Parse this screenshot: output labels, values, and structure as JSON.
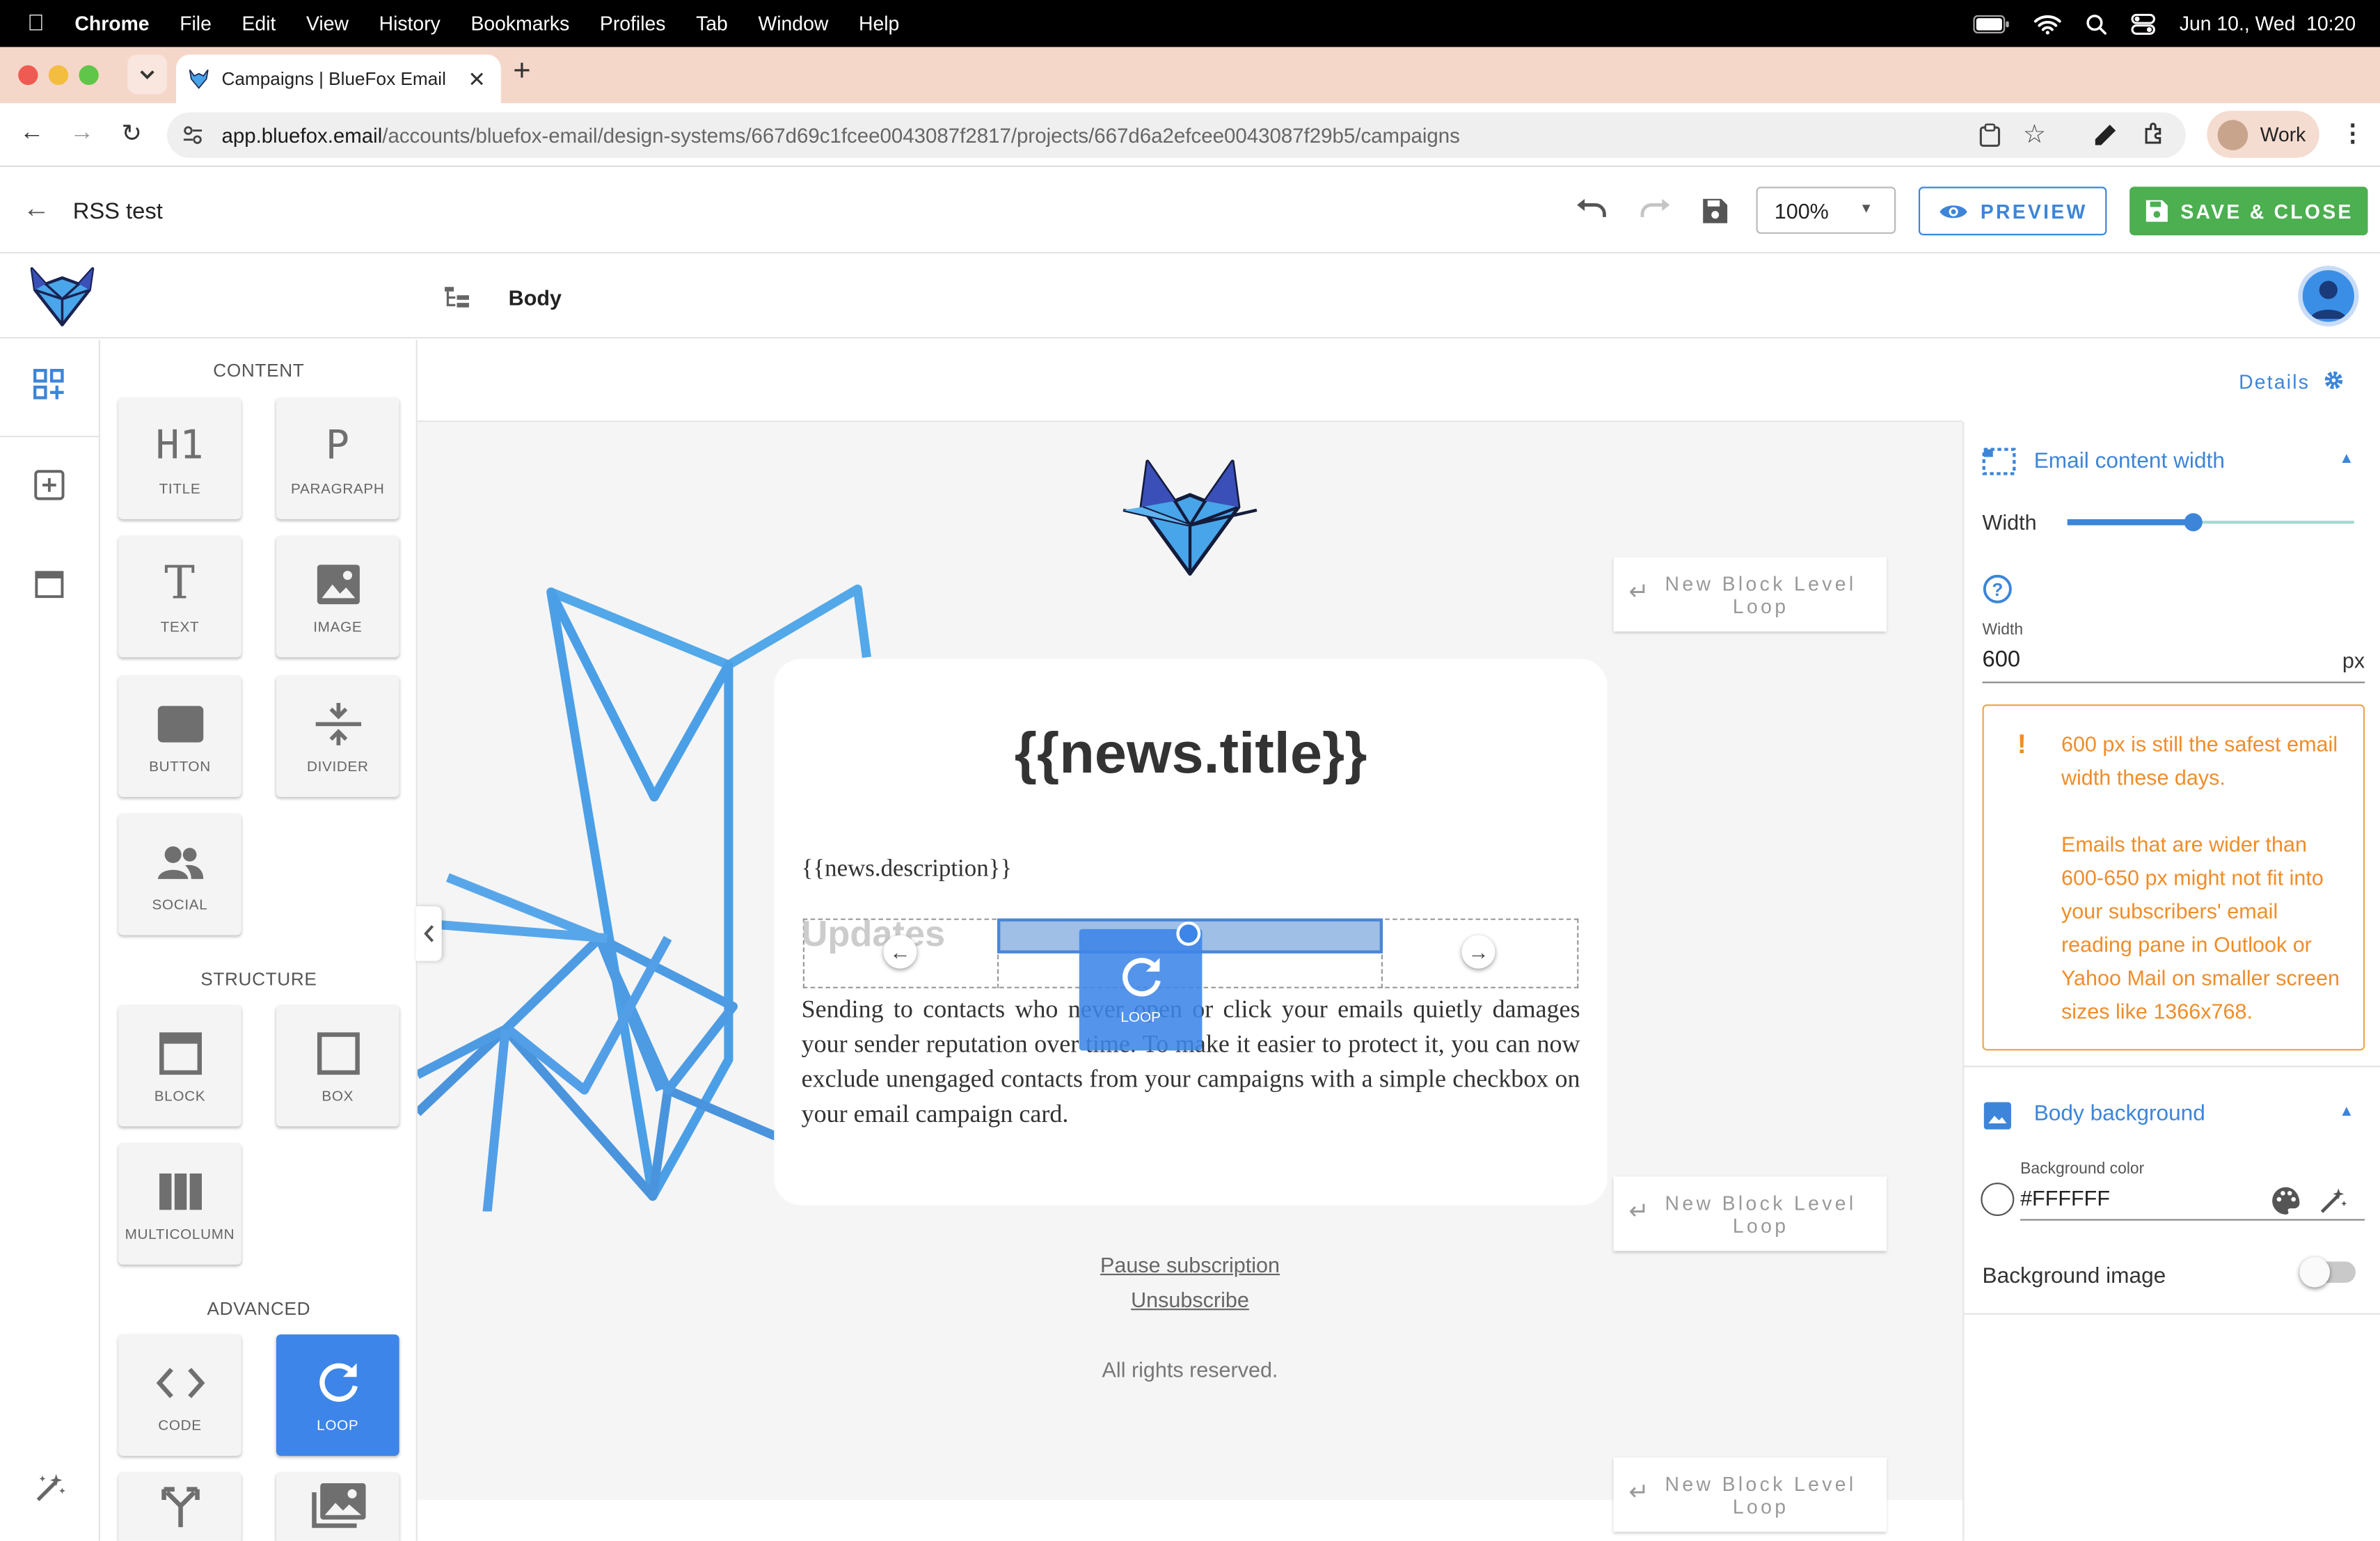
{
  "menubar": {
    "apple": "",
    "app": "Chrome",
    "items": [
      "File",
      "Edit",
      "View",
      "History",
      "Bookmarks",
      "Profiles",
      "Tab",
      "Window",
      "Help"
    ],
    "datetime": "Jun 10., Wed  10:20"
  },
  "browser": {
    "tab_title": "Campaigns | BlueFox Email",
    "url_host": "app.bluefox.email",
    "url_path": "/accounts/bluefox-email/design-systems/667d69c1fcee0043087f2817/projects/667d6a2efcee0043087f29b5/campaigns",
    "profile": "Work"
  },
  "header": {
    "title": "RSS test",
    "zoom": "100%",
    "preview_label": "PREVIEW",
    "save_label": "SAVE & CLOSE"
  },
  "subheader": {
    "breadcrumb": "Body"
  },
  "palette": {
    "content_heading": "CONTENT",
    "structure_heading": "STRUCTURE",
    "advanced_heading": "ADVANCED",
    "content": [
      {
        "label": "TITLE",
        "glyph": "H1"
      },
      {
        "label": "PARAGRAPH",
        "glyph": "P"
      },
      {
        "label": "TEXT",
        "glyph": "T"
      },
      {
        "label": "IMAGE"
      },
      {
        "label": "BUTTON"
      },
      {
        "label": "DIVIDER"
      },
      {
        "label": "SOCIAL"
      }
    ],
    "structure": [
      {
        "label": "BLOCK"
      },
      {
        "label": "BOX"
      },
      {
        "label": "MULTICOLUMN"
      }
    ],
    "advanced": [
      {
        "label": "CODE"
      },
      {
        "label": "LOOP"
      }
    ]
  },
  "canvas": {
    "details_label": "Details",
    "news_title": "{{news.title}}",
    "news_description": "{{news.description}}",
    "updates_label": "Updates",
    "drag_label": "LOOP",
    "body_text": "Sending to contacts who never open or click your emails quietly damages your sender reputation over time. To make it easier to protect it, you can now exclude unengaged contacts from your campaigns with a simple checkbox on your email campaign card.",
    "new_block_loop": "New Block Level Loop",
    "pause_link": "Pause subscription",
    "unsubscribe_link": "Unsubscribe",
    "rights": "All rights reserved."
  },
  "panel": {
    "width_section": "Email content width",
    "width_label": "Width",
    "width_slider_fraction": 0.44,
    "width_field_label": "Width",
    "width_value": "600",
    "width_unit": "px",
    "note_line1": "600 px is still the safest email width these days.",
    "note_line2": "Emails that are wider than 600-650 px might not fit into your subscribers' email reading pane in Outlook or Yahoo Mail on smaller screen sizes like 1366x768.",
    "bg_section": "Body background",
    "bg_color_label": "Background color",
    "bg_color_value": "#FFFFFF",
    "bg_image_label": "Background image"
  },
  "colors": {
    "accent": "#3d85d8",
    "save": "#4caf50",
    "warning": "#ef8d2a",
    "tab_strip": "#f5d7ca"
  }
}
